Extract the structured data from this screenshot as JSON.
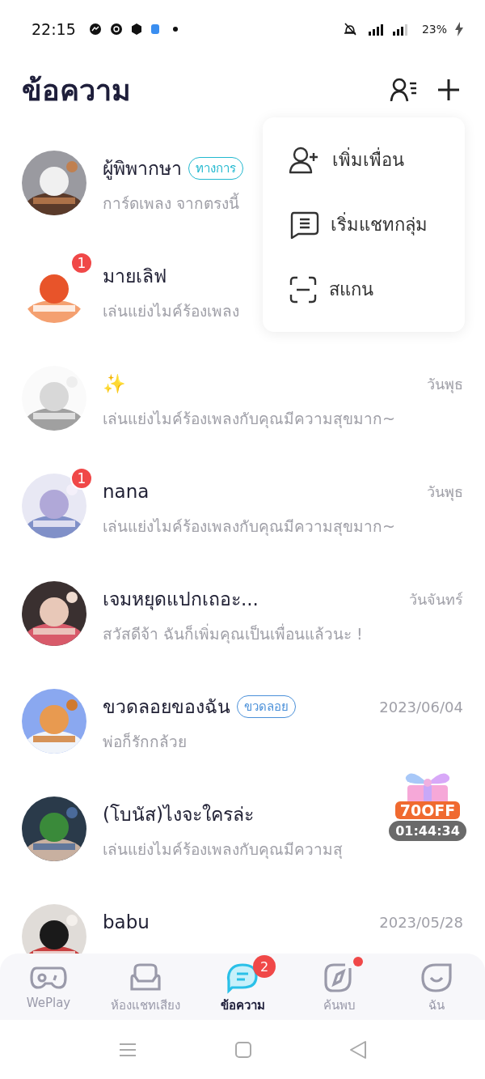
{
  "status_bar": {
    "time": "22:15",
    "battery": "23%"
  },
  "header": {
    "title": "ข้อความ"
  },
  "menu": {
    "items": [
      {
        "kind": "add-friend",
        "label": "เพิ่มเพื่อน"
      },
      {
        "kind": "group-chat",
        "label": "เริ่มแชทกลุ่ม"
      },
      {
        "kind": "scan",
        "label": "สแกน"
      }
    ]
  },
  "conversations": [
    {
      "name": "ผู้พิพากษา",
      "tag": "ทางการ",
      "color": "#22b8cf",
      "preview": "การ์ดเพลง จากตรงนี้"
    },
    {
      "name": "มายเลิฟ",
      "preview": "เล่นแย่งไมค์ร้องเพลง",
      "unread": "1"
    },
    {
      "name": "✨",
      "preview": "เล่นแย่งไมค์ร้องเพลงกับคุณมีความสุขมาก~",
      "time": "วันพุธ"
    },
    {
      "name": "nana",
      "preview": "เล่นแย่งไมค์ร้องเพลงกับคุณมีความสุขมาก~",
      "time": "วันพุธ",
      "unread": "1"
    },
    {
      "name": "เจมหยุดแปกเถอะ...",
      "preview": " สวัสดีจ้า ฉันก็เพิ่มคุณเป็นเพื่อนแล้วนะ !",
      "time": "วันจันทร์"
    },
    {
      "name": "ขวดลอยของฉัน",
      "tag": "ขวดลอย",
      "color": "#4a90d9",
      "preview": "พ่อก็รักกล้วย",
      "time": "2023/06/04"
    },
    {
      "name": "(โบนัส)ไงจะใครล่ะ",
      "preview": "เล่นแย่งไมค์ร้องเพลงกับคุณมีความสุ"
    },
    {
      "name": "babu",
      "time": "2023/05/28"
    }
  ],
  "promo": {
    "label": "70OFF",
    "countdown": "01:44:34"
  },
  "tabs": [
    {
      "label": "WePlay",
      "selected": false,
      "kind": "game",
      "dot": false
    },
    {
      "label": "ห้องแชทเสียง",
      "selected": false,
      "kind": "sofa",
      "dot": false
    },
    {
      "label": "ข้อความ",
      "selected": true,
      "kind": "chat",
      "badge": "2",
      "dot": false
    },
    {
      "label": "ค้นพบ",
      "selected": false,
      "kind": "compass",
      "dot": true
    },
    {
      "label": "ฉัน",
      "selected": false,
      "kind": "smile",
      "dot": false
    }
  ]
}
